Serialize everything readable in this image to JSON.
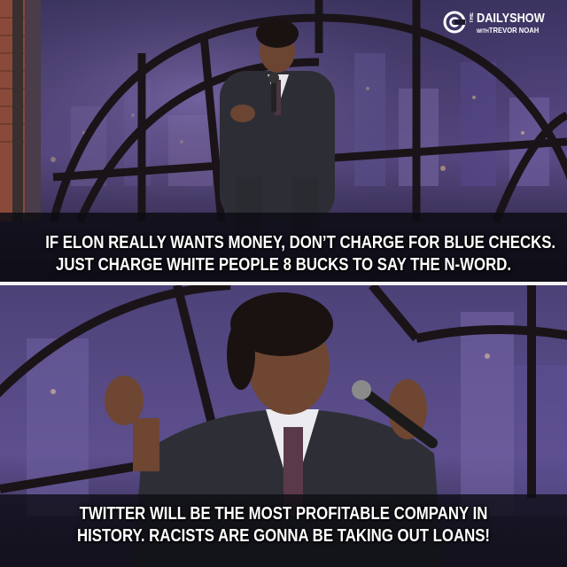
{
  "logo": {
    "the": "THE",
    "title": "DAILYSHOW",
    "with": "WITH",
    "host": "TREVOR NOAH"
  },
  "panels": [
    {
      "caption_lines": [
        "IF ELON REALLY WANTS MONEY, DON’T CHARGE FOR BLUE CHECKS.",
        "JUST CHARGE WHITE PEOPLE 8 BUCKS TO SAY THE N-WORD."
      ]
    },
    {
      "caption_lines": [
        "TWITTER WILL BE THE MOST PROFITABLE COMPANY IN",
        "HISTORY. RACISTS ARE GONNA BE TAKING OUT LOANS!"
      ]
    }
  ],
  "colors": {
    "caption_text": "#ffffff",
    "divider": "#f4f4f4",
    "stage_purple": "#4a3f73",
    "window_frame": "#1a1418"
  }
}
